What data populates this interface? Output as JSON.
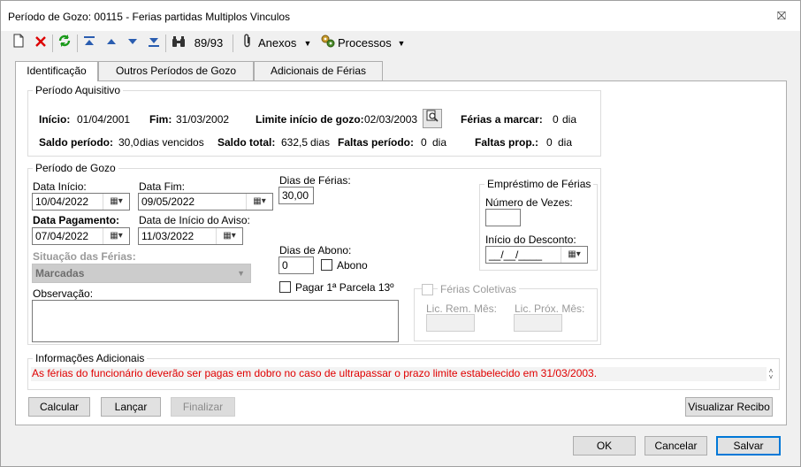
{
  "window": {
    "title": "Período de Gozo: 00115 - Ferias partidas Multiplos Vinculos",
    "close_glyph": "⛝"
  },
  "toolbar": {
    "icons": [
      "new-icon",
      "delete-icon",
      "refresh-icon",
      "first-icon",
      "prev-icon",
      "next-icon",
      "last-icon",
      "binoculars-icon",
      "paperclip-icon",
      "gears-icon"
    ],
    "record_position": "89/93",
    "anexos_label": "Anexos",
    "processos_label": "Processos"
  },
  "tabs": [
    {
      "label": "Identificação",
      "active": true
    },
    {
      "label": "Outros Períodos de Gozo",
      "active": false
    },
    {
      "label": "Adicionais de Férias",
      "active": false
    }
  ],
  "periodo_aquisitivo": {
    "legend": "Período Aquisitivo",
    "inicio_label": "Início:",
    "inicio_value": "01/04/2001",
    "fim_label": "Fim:",
    "fim_value": "31/03/2002",
    "limite_label": "Limite início de gozo:",
    "limite_value": "02/03/2003",
    "ferias_marcar_label": "Férias a marcar:",
    "ferias_marcar_value": "0",
    "ferias_marcar_unit": "dia",
    "saldo_periodo_label": "Saldo período:",
    "saldo_periodo_value": "30,0",
    "saldo_periodo_unit": "dias vencidos",
    "saldo_total_label": "Saldo total:",
    "saldo_total_value": "632,5",
    "saldo_total_unit": "dias",
    "faltas_periodo_label": "Faltas período:",
    "faltas_periodo_value": "0",
    "faltas_periodo_unit": "dia",
    "faltas_prop_label": "Faltas prop.:",
    "faltas_prop_value": "0",
    "faltas_prop_unit": "dia"
  },
  "periodo_gozo": {
    "legend": "Período de Gozo",
    "data_inicio_label": "Data Início:",
    "data_inicio_value": "10/04/2022",
    "data_fim_label": "Data Fim:",
    "data_fim_value": "09/05/2022",
    "dias_ferias_label": "Dias de Férias:",
    "dias_ferias_value": "30,00",
    "data_pagamento_label": "Data Pagamento:",
    "data_pagamento_value": "07/04/2022",
    "data_aviso_label": "Data de Início do Aviso:",
    "data_aviso_value": "11/03/2022",
    "situacao_label": "Situação das Férias:",
    "situacao_value": "Marcadas",
    "dias_abono_label": "Dias de Abono:",
    "dias_abono_value": "0",
    "abono_label": "Abono",
    "pagar_parcela_label": "Pagar 1ª Parcela 13º",
    "observacao_label": "Observação:",
    "observacao_value": ""
  },
  "emprestimo": {
    "legend": "Empréstimo de Férias",
    "numero_vezes_label": "Número de Vezes:",
    "numero_vezes_value": "",
    "inicio_desconto_label": "Início do Desconto:",
    "inicio_desconto_value": "__/__/____"
  },
  "ferias_coletivas": {
    "label": "Férias Coletivas",
    "lic_rem_label": "Lic. Rem. Mês:",
    "lic_prox_label": "Lic. Próx. Mês:"
  },
  "informacoes": {
    "legend": "Informações Adicionais",
    "message": "As férias do funcionário deverão ser pagas em dobro no caso de ultrapassar o prazo limite estabelecido em 31/03/2003.",
    "message_color": "#e00000"
  },
  "actions": {
    "calcular": "Calcular",
    "lancar": "Lançar",
    "finalizar": "Finalizar",
    "visualizar_recibo": "Visualizar Recibo"
  },
  "footer": {
    "ok": "OK",
    "cancelar": "Cancelar",
    "salvar": "Salvar"
  }
}
